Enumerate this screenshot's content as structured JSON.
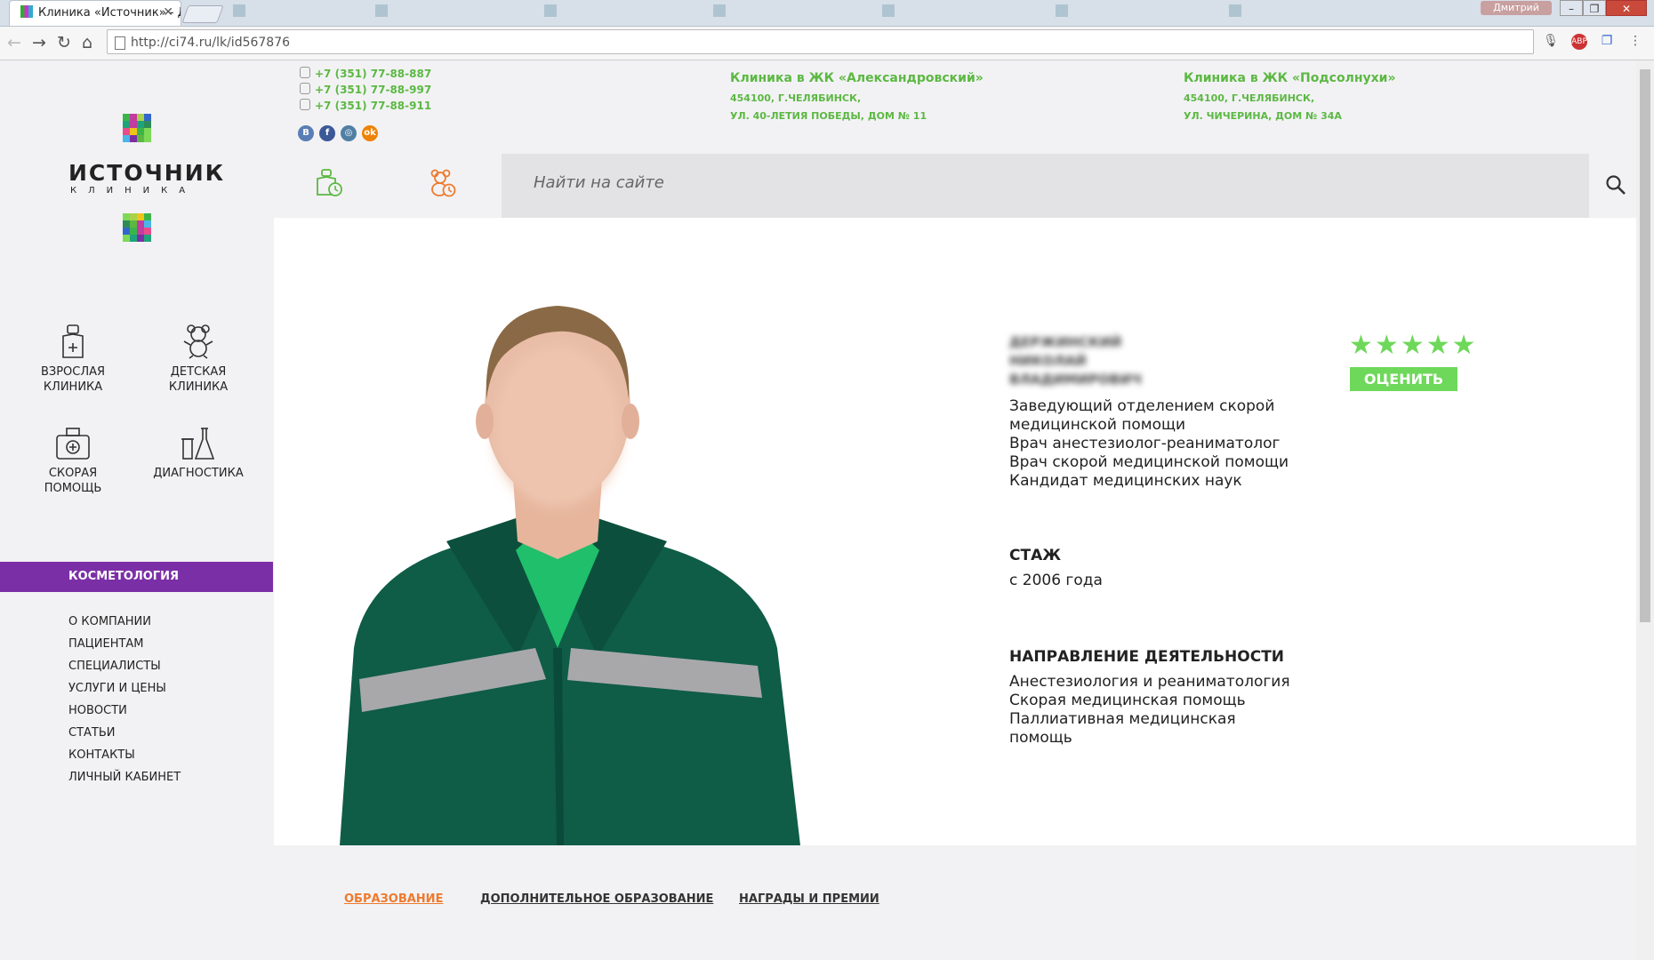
{
  "browser": {
    "active_tab_title": "Клиника «Источник» - Д",
    "url": "http://ci74.ru/lk/id567876",
    "user": "Дмитрий",
    "abp_count": "1"
  },
  "logo": {
    "name": "ИСТОЧНИК",
    "sub": "КЛИНИКА",
    "mosaic_colors": [
      "#3bb54a",
      "#7ed957",
      "#1fa37a",
      "#c33ca0",
      "#4ab6e8",
      "#2e8b57",
      "#a8d24a",
      "#7b2fa6",
      "#e84c8b",
      "#36c",
      "#5cb843",
      "#f0c419",
      "#1fa37a",
      "#7ed957",
      "#3bb54a",
      "#c33ca0"
    ]
  },
  "categories": [
    {
      "label_1": "ВЗРОСЛАЯ",
      "label_2": "КЛИНИКА",
      "icon": "adult-clinic-icon"
    },
    {
      "label_1": "ДЕТСКАЯ",
      "label_2": "КЛИНИКА",
      "icon": "teddy-bear-icon"
    },
    {
      "label_1": "СКОРАЯ",
      "label_2": "ПОМОЩЬ",
      "icon": "medkit-icon"
    },
    {
      "label_1": "ДИАГНОСТИКА",
      "label_2": "",
      "icon": "lab-flask-icon"
    }
  ],
  "highlight_menu": "КОСМЕТОЛОГИЯ",
  "menu": [
    "О КОМПАНИИ",
    "ПАЦИЕНТАМ",
    "СПЕЦИАЛИСТЫ",
    "УСЛУГИ И ЦЕНЫ",
    "НОВОСТИ",
    "СТАТЬИ",
    "КОНТАКТЫ",
    "ЛИЧНЫЙ КАБИНЕТ"
  ],
  "phones": [
    "+7 (351) 77-88-887",
    "+7 (351) 77-88-997",
    "+7 (351) 77-88-911"
  ],
  "socials": [
    {
      "label": "В",
      "color": "#5a7db5"
    },
    {
      "label": "f",
      "color": "#3b5998"
    },
    {
      "label": "◎",
      "color": "#517fa4"
    },
    {
      "label": "ok",
      "color": "#ee8208"
    }
  ],
  "clinics": [
    {
      "title": "Клиника в ЖК «Александровский»",
      "line1": "454100, Г.ЧЕЛЯБИНСК,",
      "line2": "УЛ. 40-ЛЕТИЯ ПОБЕДЫ, ДОМ № 11"
    },
    {
      "title": "Клиника в ЖК «Подсолнухи»",
      "line1": "454100, Г.ЧЕЛЯБИНСК,",
      "line2": "УЛ. ЧИЧЕРИНА, ДОМ № 34А"
    }
  ],
  "search": {
    "placeholder": "Найти на сайте"
  },
  "doctor": {
    "name_lines": [
      "ДЕРЖИНСКИЙ",
      "НИКОЛАЙ",
      "ВЛАДИМИРОВИЧ"
    ],
    "positions": [
      "Заведующий отделением скорой",
      "медицинской помощи",
      "Врач анестезиолог-реаниматолог",
      "Врач скорой медицинской помощи",
      "Кандидат медицинских наук"
    ],
    "rating_stars": 5,
    "rate_label": "ОЦЕНИТЬ",
    "experience_heading": "СТАЖ",
    "experience": "с 2006 года",
    "activity_heading": "НАПРАВЛЕНИЕ ДЕЯТЕЛЬНОСТИ",
    "activities": [
      "Анестезиология  и реаниматология",
      "Скорая медицинская помощь",
      "Паллиативная медицинская",
      "помощь"
    ]
  },
  "profile_tabs": [
    "ОБРАЗОВАНИЕ",
    "ДОПОЛНИТЕЛЬНОЕ ОБРАЗОВАНИЕ",
    "НАГРАДЫ И ПРЕМИИ"
  ],
  "colors": {
    "accent_green": "#5cb843",
    "star_green": "#6ed85a",
    "purple": "#7b2fa6",
    "orange": "#ee7a2e"
  }
}
